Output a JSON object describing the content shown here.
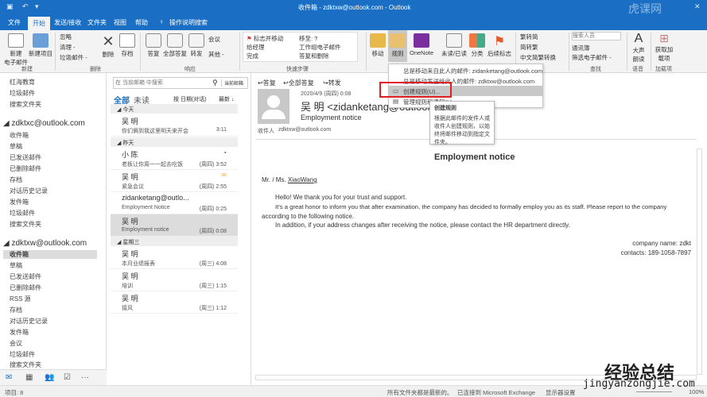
{
  "window": {
    "title": "收件箱 - zdktxw@outlook.com - Outlook"
  },
  "tabs": [
    "文件",
    "开始",
    "发送/接收",
    "文件夹",
    "视图",
    "帮助",
    "操作说明搜索"
  ],
  "ribbon": {
    "new": {
      "new_email": "新建\n电子邮件",
      "new_items": "新建项目",
      "label": "新建"
    },
    "delete": {
      "ignore": "忽略",
      "cleanup": "清理 -",
      "junk": "垃圾邮件 -",
      "delete": "删除",
      "archive": "存档",
      "label": "删除"
    },
    "respond": {
      "reply": "答复",
      "reply_all": "全部答复",
      "forward": "转发",
      "meeting": "会议",
      "more": "其他 -",
      "label": "响应"
    },
    "quick_steps": {
      "items": [
        "标志并移动",
        "给经理",
        "完成",
        "移至: ?",
        "工作组电子邮件",
        "答复和删除"
      ],
      "label": "快速步骤"
    },
    "move": {
      "move": "移动",
      "rules": "规则",
      "onenote": "OneNote"
    },
    "tags": {
      "unread": "未读/已读",
      "categorize": "分类",
      "followup": "后续标志"
    },
    "chinese": {
      "t2s": "繁转简",
      "s2t": "简转繁",
      "conv": "中文简繁转换",
      "label": "中文简繁转换"
    },
    "find": {
      "search_people_placeholder": "搜索人员",
      "address_book": "通讯簿",
      "filter": "筛选电子邮件 -",
      "label": "查找"
    },
    "speech": {
      "read_aloud": "大声朗读",
      "label": "语音"
    },
    "addins": {
      "get": "获取加载项",
      "label": "加载项"
    }
  },
  "rules_menu": {
    "items": [
      "总是移动来自此人的邮件: zidanketang@outlook.com",
      "总是移动发送给此人的邮件: zdktxw@outlook.com",
      "创建规则(U)...",
      "管理规则和通知(L)..."
    ],
    "tooltip_title": "创建规则",
    "tooltip_body": "根据此邮件的发件人或收件人创建规则，以始终将邮件移动到指定文件夹。"
  },
  "nav": {
    "top_folders": [
      "红海教育",
      "垃圾邮件",
      "搜索文件夹"
    ],
    "accounts": [
      {
        "name": "zdktxc@outlook.com",
        "folders": [
          "收件箱",
          "草稿",
          "已发送邮件",
          "已删除邮件",
          "存档",
          "对话历史记录",
          "发件箱",
          "垃圾邮件",
          "搜索文件夹"
        ]
      },
      {
        "name": "zdktxw@outlook.com",
        "folders": [
          "收件箱",
          "草稿",
          "已发送邮件",
          "已删除邮件",
          "RSS 源",
          "存档",
          "对话历史记录",
          "发件箱",
          "会议",
          "垃圾邮件",
          "搜索文件夹"
        ]
      }
    ]
  },
  "list": {
    "search_placeholder": "在 当前邮箱 中搜索",
    "scope": "当前邮箱",
    "filter_all": "全部",
    "filter_unread": "未读",
    "sort": "按 日期(对话)",
    "order": "最新 ↓",
    "groups": [
      {
        "label": "今天",
        "items": [
          {
            "sender": "吴 明",
            "subject": "你们俩到我这里明天来开会",
            "time": "3:11"
          }
        ]
      },
      {
        "label": "昨天",
        "items": [
          {
            "sender": "小 陈",
            "subject": "老板让你周一一起去吃饭",
            "time": "(周四) 3:52"
          },
          {
            "sender": "吴 明",
            "subject": "紧急会议",
            "time": "(周四) 2:55"
          },
          {
            "sender": "zidanketang@outlo...",
            "subject": "Employment Notice",
            "time": "(周四) 0:25"
          },
          {
            "sender": "吴 明",
            "subject": "Employment notice",
            "time": "(周四) 0:08"
          }
        ]
      },
      {
        "label": "星期三",
        "items": [
          {
            "sender": "吴 明",
            "subject": "本月业绩报表",
            "time": "(周三) 4:08"
          },
          {
            "sender": "吴 明",
            "subject": "培训",
            "time": "(周三) 1:15"
          },
          {
            "sender": "吴 明",
            "subject": "接风",
            "time": "(周三) 1:12"
          }
        ]
      }
    ]
  },
  "reading": {
    "actions": [
      "答复",
      "全部答复",
      "转发"
    ],
    "date": "2020/4/9 (周四) 0:08",
    "from": "吴 明 <zidanketang@outlook.com>",
    "subject": "Employment notice",
    "to_label": "收件人",
    "to": "zdktxw@outlook.com",
    "body": {
      "title": "Employment notice",
      "salutation": "Mr. / Ms.",
      "name": "XiaoWang",
      "p1": "Hello! We thank you for your trust and support.",
      "p2a": "It's a great honor to inform you that after examination, the company has decided to formally employ you as its staff. Please report to the company",
      "p2b": "according to the following notice.",
      "p3": "In addition, if your address changes after receiving the notice, please contact the HR department directly.",
      "company": "company name: zdkt",
      "contacts": "contacts: 189-1058-7897"
    }
  },
  "status": {
    "items": "项目: 8",
    "sync": "所有文件夹都是最新的。",
    "connected": "已连接到 Microsoft Exchange",
    "display": "显示器设置",
    "zoom": "100%"
  },
  "watermark": {
    "cn": "经验总结",
    "url": "jingyanzongjie.com",
    "brand": "虎课网"
  }
}
